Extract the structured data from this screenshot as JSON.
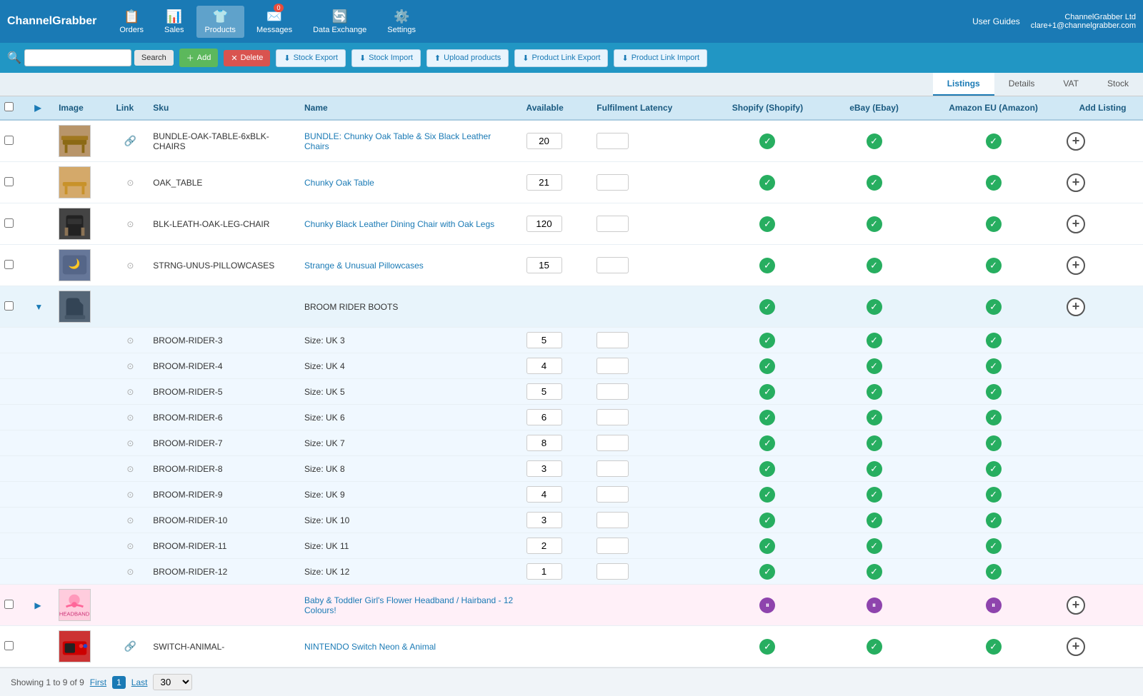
{
  "app": {
    "logo": "ChannelGrabber",
    "user_guides": "User Guides",
    "company": "ChannelGrabber Ltd",
    "email": "clare+1@channelgrabber.com"
  },
  "nav": {
    "items": [
      {
        "id": "orders",
        "label": "Orders",
        "icon": "📋"
      },
      {
        "id": "sales",
        "label": "Sales",
        "icon": "📊"
      },
      {
        "id": "products",
        "label": "Products",
        "icon": "👕",
        "active": true
      },
      {
        "id": "messages",
        "label": "Messages",
        "icon": "✉️",
        "badge": "0"
      },
      {
        "id": "data-exchange",
        "label": "Data Exchange",
        "icon": "🔄"
      },
      {
        "id": "settings",
        "label": "Settings",
        "icon": "⚙️"
      }
    ]
  },
  "toolbar": {
    "search_placeholder": "",
    "search_label": "Search",
    "add_label": "Add",
    "delete_label": "Delete",
    "stock_export_label": "Stock Export",
    "stock_import_label": "Stock Import",
    "upload_products_label": "Upload products",
    "product_link_export_label": "Product Link Export",
    "product_link_import_label": "Product Link Import"
  },
  "tabs": [
    {
      "id": "listings",
      "label": "Listings",
      "active": true
    },
    {
      "id": "details",
      "label": "Details"
    },
    {
      "id": "vat",
      "label": "VAT"
    },
    {
      "id": "stock",
      "label": "Stock"
    }
  ],
  "table": {
    "columns": [
      {
        "id": "check",
        "label": ""
      },
      {
        "id": "expand",
        "label": ""
      },
      {
        "id": "image",
        "label": "Image"
      },
      {
        "id": "link",
        "label": "Link"
      },
      {
        "id": "sku",
        "label": "Sku"
      },
      {
        "id": "name",
        "label": "Name"
      },
      {
        "id": "available",
        "label": "Available"
      },
      {
        "id": "fulfillment",
        "label": "Fulfilment Latency"
      },
      {
        "id": "shopify",
        "label": "Shopify (Shopify)"
      },
      {
        "id": "ebay",
        "label": "eBay (Ebay)"
      },
      {
        "id": "amazon",
        "label": "Amazon EU (Amazon)"
      },
      {
        "id": "addlisting",
        "label": "Add Listing"
      }
    ],
    "rows": [
      {
        "id": "row-1",
        "type": "product",
        "expanded": false,
        "has_image": true,
        "img_color": "#b8956a",
        "has_link": true,
        "sku": "BUNDLE-OAK-TABLE-6xBLK-CHAIRS",
        "name": "BUNDLE: Chunky Oak Table & Six Black Leather Chairs",
        "available": "20",
        "shopify": "check",
        "ebay": "check",
        "amazon": "check",
        "add_listing": true
      },
      {
        "id": "row-2",
        "type": "product",
        "expanded": false,
        "has_image": true,
        "img_color": "#d4a96a",
        "has_link": false,
        "sku": "OAK_TABLE",
        "name": "Chunky Oak Table",
        "available": "21",
        "shopify": "check",
        "ebay": "check",
        "amazon": "check",
        "add_listing": true
      },
      {
        "id": "row-3",
        "type": "product",
        "expanded": false,
        "has_image": true,
        "img_color": "#333333",
        "has_link": false,
        "sku": "BLK-LEATH-OAK-LEG-CHAIR",
        "name": "Chunky Black Leather Dining Chair with Oak Legs",
        "available": "120",
        "shopify": "check",
        "ebay": "check",
        "amazon": "check",
        "add_listing": true
      },
      {
        "id": "row-4",
        "type": "product",
        "expanded": false,
        "has_image": true,
        "img_color": "#556677",
        "has_link": false,
        "sku": "STRNG-UNUS-PILLOWCASES",
        "name": "Strange & Unusual Pillowcases",
        "available": "15",
        "shopify": "check",
        "ebay": "check",
        "amazon": "check",
        "add_listing": true
      },
      {
        "id": "row-5",
        "type": "parent",
        "expanded": true,
        "has_image": true,
        "img_color": "#445566",
        "has_link": false,
        "sku": "",
        "name": "BROOM RIDER BOOTS",
        "available": "",
        "shopify": "check",
        "ebay": "check",
        "amazon": "check",
        "add_listing": true
      },
      {
        "id": "row-5-v3",
        "type": "variant",
        "sku": "BROOM-RIDER-3",
        "name": "Size: UK 3",
        "available": "5",
        "shopify": "check",
        "ebay": "check",
        "amazon": "check"
      },
      {
        "id": "row-5-v4",
        "type": "variant",
        "sku": "BROOM-RIDER-4",
        "name": "Size: UK 4",
        "available": "4",
        "shopify": "check",
        "ebay": "check",
        "amazon": "check"
      },
      {
        "id": "row-5-v5",
        "type": "variant",
        "sku": "BROOM-RIDER-5",
        "name": "Size: UK 5",
        "available": "5",
        "shopify": "check",
        "ebay": "check",
        "amazon": "check"
      },
      {
        "id": "row-5-v6",
        "type": "variant",
        "sku": "BROOM-RIDER-6",
        "name": "Size: UK 6",
        "available": "6",
        "shopify": "check",
        "ebay": "check",
        "amazon": "check"
      },
      {
        "id": "row-5-v7",
        "type": "variant",
        "sku": "BROOM-RIDER-7",
        "name": "Size: UK 7",
        "available": "8",
        "shopify": "check",
        "ebay": "check",
        "amazon": "check"
      },
      {
        "id": "row-5-v8",
        "type": "variant",
        "sku": "BROOM-RIDER-8",
        "name": "Size: UK 8",
        "available": "3",
        "shopify": "check",
        "ebay": "check",
        "amazon": "check"
      },
      {
        "id": "row-5-v9",
        "type": "variant",
        "sku": "BROOM-RIDER-9",
        "name": "Size: UK 9",
        "available": "4",
        "shopify": "check",
        "ebay": "check",
        "amazon": "check"
      },
      {
        "id": "row-5-v10",
        "type": "variant",
        "sku": "BROOM-RIDER-10",
        "name": "Size: UK 10",
        "available": "3",
        "shopify": "check",
        "ebay": "check",
        "amazon": "check"
      },
      {
        "id": "row-5-v11",
        "type": "variant",
        "sku": "BROOM-RIDER-11",
        "name": "Size: UK 11",
        "available": "2",
        "shopify": "check",
        "ebay": "check",
        "amazon": "check"
      },
      {
        "id": "row-5-v12",
        "type": "variant",
        "sku": "BROOM-RIDER-12",
        "name": "Size: UK 12",
        "available": "1",
        "shopify": "check",
        "ebay": "check",
        "amazon": "check"
      },
      {
        "id": "row-6",
        "type": "parent",
        "expanded": false,
        "has_image": true,
        "img_color": "#ffaacc",
        "has_link": false,
        "sku": "",
        "name": "Baby & Toddler Girl's Flower Headband / Hairband - 12 Colours!",
        "available": "",
        "shopify": "pause",
        "ebay": "pause",
        "amazon": "pause",
        "add_listing": true
      },
      {
        "id": "row-7",
        "type": "product",
        "expanded": false,
        "has_image": true,
        "img_color": "#cc3333",
        "has_link": true,
        "sku": "SWITCH-ANIMAL-",
        "name": "NINTENDO Switch Neon & Animal",
        "available": "",
        "shopify": "check",
        "ebay": "check",
        "amazon": "check",
        "add_listing": true
      }
    ]
  },
  "footer": {
    "showing": "Showing 1 to 9 of 9",
    "first": "First",
    "page": "1",
    "last": "Last",
    "per_page": "30"
  }
}
